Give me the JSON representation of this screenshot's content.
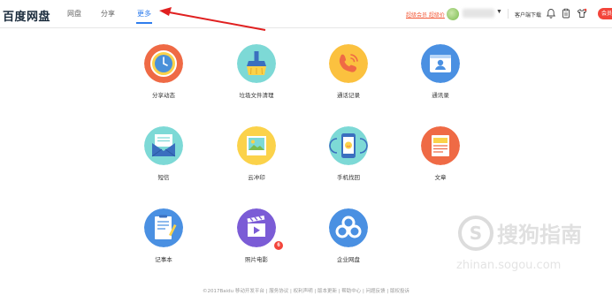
{
  "header": {
    "logo": "百度网盘",
    "nav": [
      "网盘",
      "分享",
      "更多"
    ],
    "active_nav": "更多",
    "vip_link": "超级会员 超级价",
    "client_download": "客户端下载",
    "red_button": "会员中"
  },
  "apps": [
    {
      "label": "分享动态",
      "icon": "clock-icon"
    },
    {
      "label": "垃圾文件清理",
      "icon": "broom-icon"
    },
    {
      "label": "通话记录",
      "icon": "phone-icon"
    },
    {
      "label": "通讯录",
      "icon": "contact-card-icon"
    },
    {
      "label": "短信",
      "icon": "envelope-icon"
    },
    {
      "label": "云冲印",
      "icon": "photo-print-icon"
    },
    {
      "label": "手机找回",
      "icon": "phone-find-icon"
    },
    {
      "label": "文章",
      "icon": "article-icon"
    },
    {
      "label": "记事本",
      "icon": "notepad-icon"
    },
    {
      "label": "照片电影",
      "icon": "clapperboard-icon",
      "badge": "6"
    },
    {
      "label": "企业网盘",
      "icon": "cloud-icon"
    }
  ],
  "footer": "©2017Baidu  移动开发平台 | 服务协议 | 权利声明 | 版本更新 | 帮助中心 | 问题反馈 | 版权投诉",
  "watermark": {
    "title": "搜狗指南",
    "url": "zhinan.sogou.com"
  },
  "colors": {
    "accent": "#2f7ded",
    "vip": "#f35b3a"
  }
}
